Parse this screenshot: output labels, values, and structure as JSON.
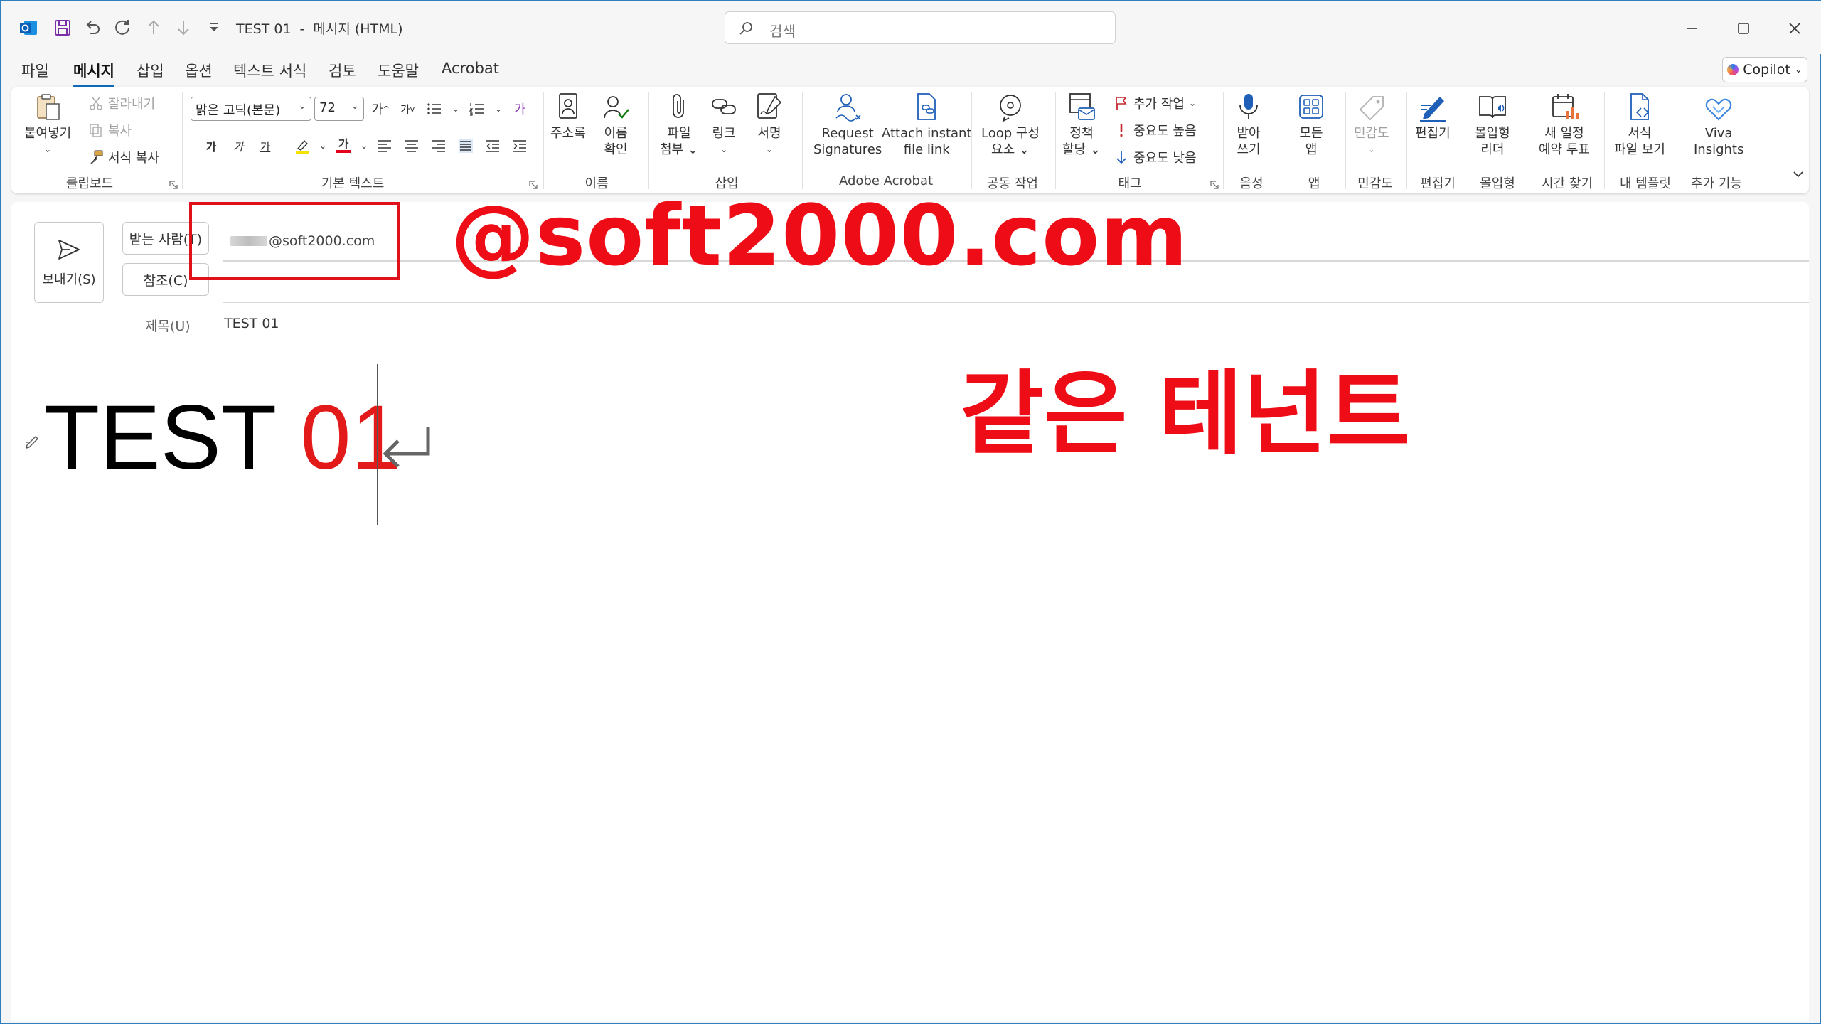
{
  "window": {
    "title": "TEST 01",
    "separator": "-",
    "subtitle": "메시지 (HTML)",
    "search_placeholder": "검색"
  },
  "tabs": [
    {
      "label": "파일"
    },
    {
      "label": "메시지",
      "active": true
    },
    {
      "label": "삽입"
    },
    {
      "label": "옵션"
    },
    {
      "label": "텍스트 서식"
    },
    {
      "label": "검토"
    },
    {
      "label": "도움말"
    },
    {
      "label": "Acrobat"
    }
  ],
  "copilot_label": "Copilot",
  "ribbon": {
    "clipboard": {
      "paste": "붙여넣기",
      "cut": "잘라내기",
      "copy": "복사",
      "format_painter": "서식 복사",
      "group": "클립보드"
    },
    "basic_text": {
      "font": "맑은 고딕(본문)",
      "size": "72",
      "bold": "가",
      "italic": "가",
      "underline": "가",
      "font_color_glyph": "가",
      "grow": "가",
      "shrink": "가",
      "clear": "가",
      "group": "기본 텍스트"
    },
    "names": {
      "address_book": "주소록",
      "check_names_1": "이름",
      "check_names_2": "확인",
      "group": "이름"
    },
    "include": {
      "attach_1": "파일",
      "attach_2": "첨부",
      "link": "링크",
      "signature": "서명",
      "group": "삽입"
    },
    "acrobat": {
      "request_1": "Request",
      "request_2": "Signatures",
      "attach_1": "Attach instant",
      "attach_2": "file link",
      "group": "Adobe Acrobat"
    },
    "collab": {
      "loop_1": "Loop 구성",
      "loop_2": "요소",
      "group": "공동 작업"
    },
    "tags": {
      "policy_1": "정책",
      "policy_2": "할당",
      "followup": "추가 작업",
      "high": "중요도 높음",
      "low": "중요도 낮음",
      "group": "태그"
    },
    "voice": {
      "dictate_1": "받아",
      "dictate_2": "쓰기",
      "group": "음성"
    },
    "apps": {
      "all_1": "모든",
      "all_2": "앱",
      "group": "앱"
    },
    "sensitivity": {
      "label": "민감도",
      "group": "민감도"
    },
    "editor": {
      "label": "편집기",
      "group": "편집기"
    },
    "immersive": {
      "label_1": "몰입형",
      "label_2": "리더",
      "group": "몰입형"
    },
    "find_time": {
      "label_1": "새 일정",
      "label_2": "예약 투표",
      "group": "시간 찾기"
    },
    "templates": {
      "label_1": "서식",
      "label_2": "파일 보기",
      "group": "내 템플릿"
    },
    "addins": {
      "label_1": "Viva",
      "label_2": "Insights",
      "group": "추가 기능"
    }
  },
  "compose": {
    "send": "보내기(S)",
    "to": "받는 사람(T)",
    "cc": "참조(C)",
    "recipient_domain": "@soft2000.com",
    "subject_label": "제목(U)",
    "subject": "TEST 01"
  },
  "body": {
    "text_black": "TEST ",
    "text_red": "01"
  },
  "annotations": {
    "domain": "@soft2000.com",
    "tenant": "같은 테넌트"
  },
  "colors": {
    "accent": "#0f6cbd",
    "annotation_red": "#ee0d16",
    "frame": "#2f7fc0"
  }
}
